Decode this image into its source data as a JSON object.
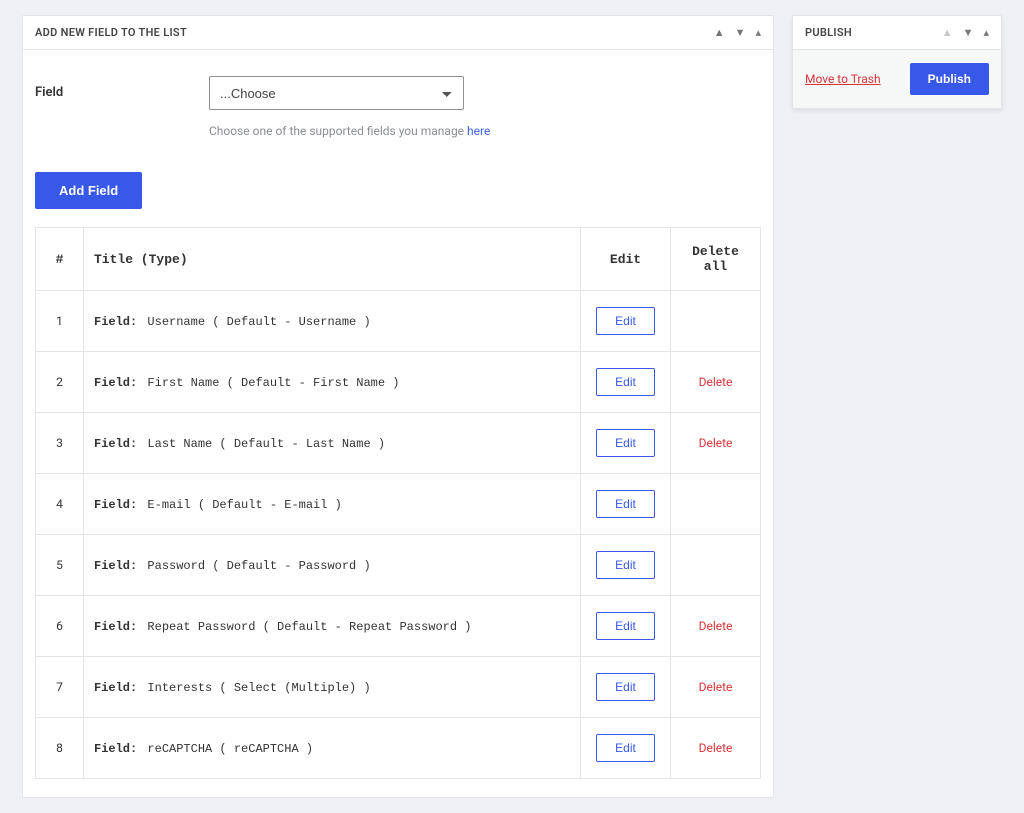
{
  "main": {
    "panel_title": "ADD NEW FIELD TO THE LIST",
    "field_label": "Field",
    "choose_placeholder": "...Choose",
    "help_text": "Choose one of the supported fields you manage ",
    "help_link": "here",
    "add_button": "Add Field"
  },
  "table": {
    "headers": {
      "num": "#",
      "title": "Title (Type)",
      "edit": "Edit",
      "delete_all": "Delete all"
    },
    "field_prefix": "Field:",
    "edit_label": "Edit",
    "delete_label": "Delete",
    "rows": [
      {
        "num": "1",
        "value": "Username ( Default - Username )",
        "deletable": false
      },
      {
        "num": "2",
        "value": "First Name ( Default - First Name )",
        "deletable": true
      },
      {
        "num": "3",
        "value": "Last Name ( Default - Last Name )",
        "deletable": true
      },
      {
        "num": "4",
        "value": "E-mail ( Default - E-mail )",
        "deletable": false
      },
      {
        "num": "5",
        "value": "Password ( Default - Password )",
        "deletable": false
      },
      {
        "num": "6",
        "value": "Repeat Password ( Default - Repeat Password )",
        "deletable": true
      },
      {
        "num": "7",
        "value": "Interests ( Select (Multiple) )",
        "deletable": true
      },
      {
        "num": "8",
        "value": "reCAPTCHA ( reCAPTCHA )",
        "deletable": true
      }
    ]
  },
  "publish": {
    "panel_title": "PUBLISH",
    "trash": "Move to Trash",
    "button": "Publish"
  }
}
